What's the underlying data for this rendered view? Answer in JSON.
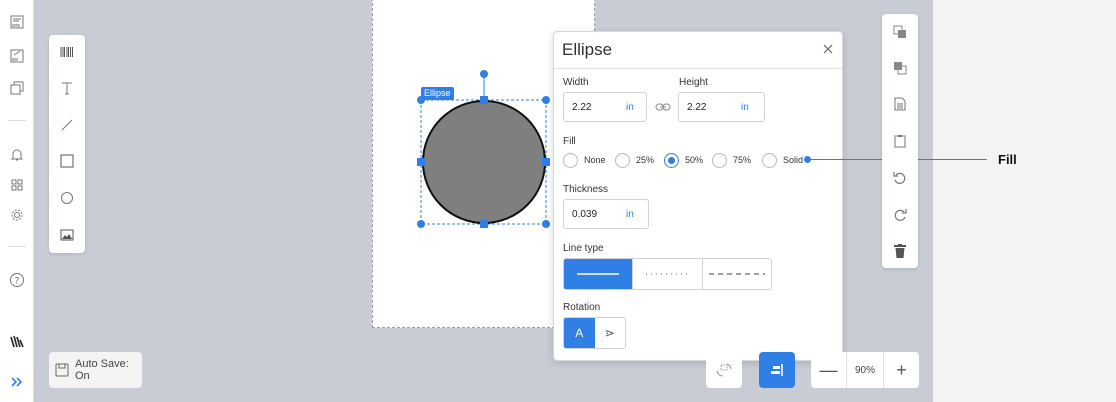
{
  "shape": {
    "tag": "Ellipse",
    "fill_color": "#7f7f7f",
    "accent": "#2f7fe6"
  },
  "panel": {
    "title": "Ellipse",
    "width_label": "Width",
    "width_value": "2.22",
    "width_unit": "in",
    "height_label": "Height",
    "height_value": "2.22",
    "height_unit": "in",
    "fill_label": "Fill",
    "fill_options": [
      "None",
      "25%",
      "50%",
      "75%",
      "Solid"
    ],
    "fill_selected": "50%",
    "thickness_label": "Thickness",
    "thickness_value": "0.039",
    "thickness_unit": "in",
    "linetype_label": "Line type",
    "linetype_options": [
      "solid",
      "dotted",
      "dashed"
    ],
    "linetype_selected": "solid",
    "rotation_label": "Rotation",
    "rotation_options": [
      "A",
      "⋗"
    ],
    "rotation_selected": "A"
  },
  "callout": {
    "text": "Fill"
  },
  "autosave": {
    "label": "Auto Save: On"
  },
  "zoom": {
    "level": "90%",
    "minus": "—",
    "plus": "+"
  },
  "icons": {
    "rail": [
      "barcode-doc-icon",
      "edit-doc-icon",
      "copy-doc-icon",
      "bell-icon",
      "grid-icon",
      "gear-icon",
      "help-icon",
      "zebra-logo-icon",
      "expand-chevrons-icon"
    ],
    "toolbox": [
      "barcode-icon",
      "text-icon",
      "line-icon",
      "rectangle-icon",
      "ellipse-icon",
      "image-icon"
    ],
    "right": [
      "send-back-icon",
      "bring-front-icon",
      "copy-icon",
      "paste-icon",
      "undo-icon",
      "redo-icon",
      "delete-icon"
    ]
  }
}
